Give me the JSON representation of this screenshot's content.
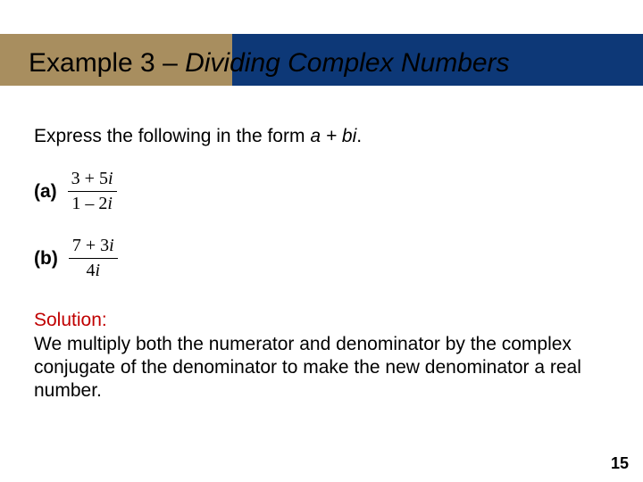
{
  "title": {
    "prefix": "Example 3 – ",
    "italic": "Dividing Complex Numbers"
  },
  "instruction": {
    "pre": "Express the following in the form ",
    "expr": "a + bi",
    "post": "."
  },
  "parts": {
    "a": {
      "label": "(a)",
      "num_plain": "3 + 5",
      "num_i": "i",
      "den_plain": "1 – 2",
      "den_i": "i"
    },
    "b": {
      "label": "(b)",
      "num_plain": "7 + 3",
      "num_i": "i",
      "den_plain": "4",
      "den_i": "i"
    }
  },
  "solution": {
    "heading": "Solution:",
    "text": "We multiply both the numerator and denominator by the complex conjugate of the denominator to make the new denominator a real number."
  },
  "page_number": "15"
}
